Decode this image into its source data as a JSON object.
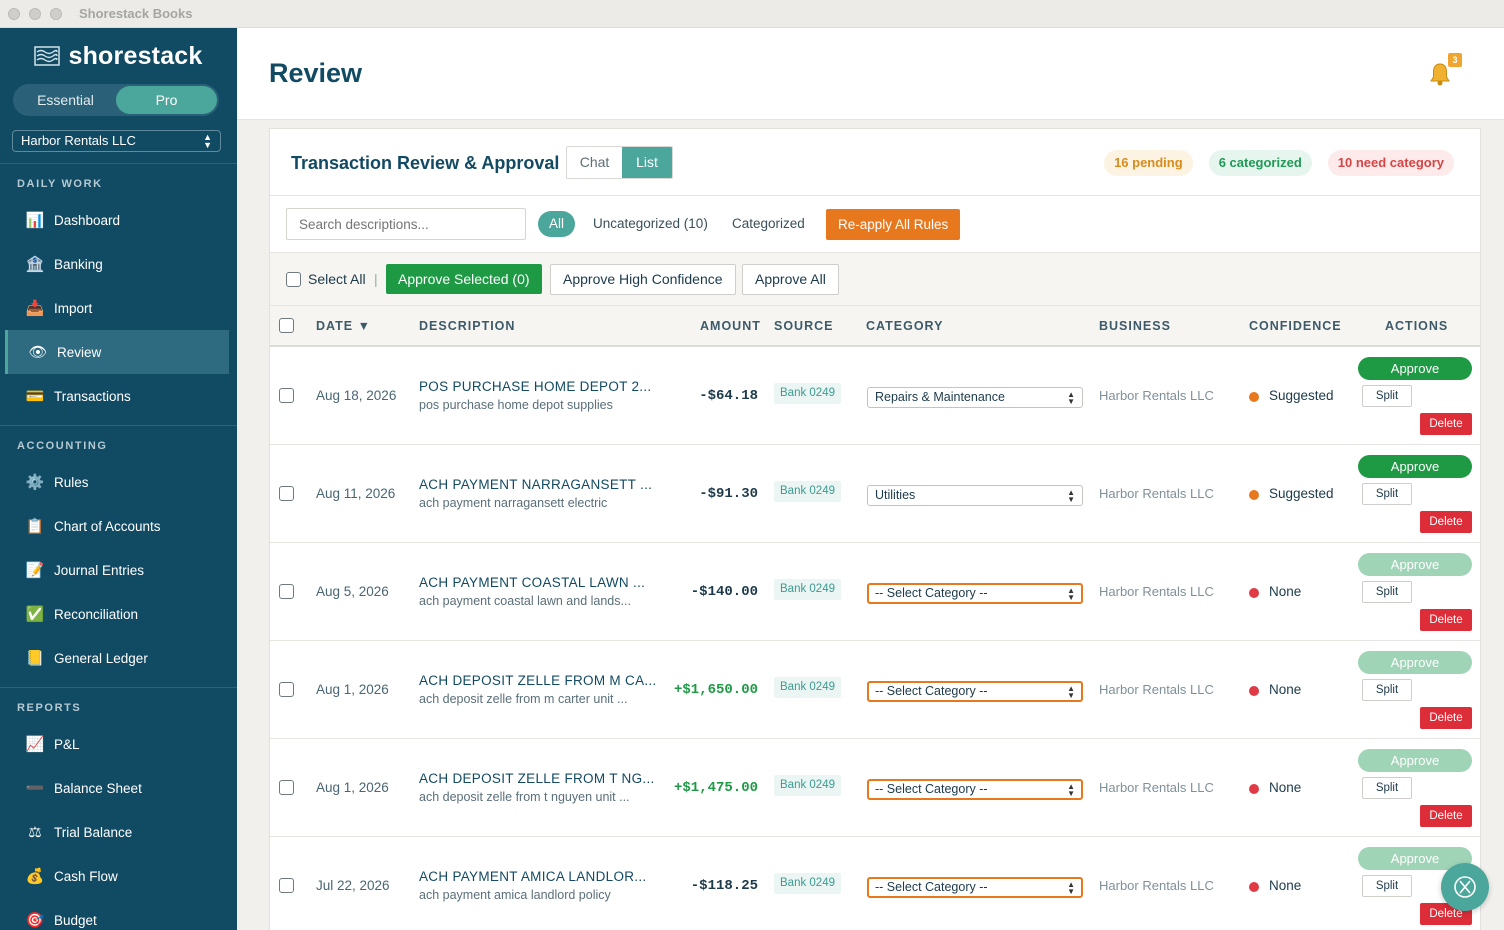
{
  "window": {
    "title": "Shorestack Books"
  },
  "brand": {
    "name": "shorestack"
  },
  "plans": {
    "essential": "Essential",
    "pro": "Pro"
  },
  "company": {
    "selected": "Harbor Rentals LLC"
  },
  "sidebar": {
    "sections": [
      {
        "label": "DAILY WORK"
      },
      {
        "label": "ACCOUNTING"
      },
      {
        "label": "REPORTS"
      }
    ],
    "items": [
      {
        "label": "Dashboard",
        "icon": "📊"
      },
      {
        "label": "Banking",
        "icon": "🏦"
      },
      {
        "label": "Import",
        "icon": "📥"
      },
      {
        "label": "Review",
        "icon": "👁"
      },
      {
        "label": "Transactions",
        "icon": "💳"
      },
      {
        "label": "Rules",
        "icon": "⚙️"
      },
      {
        "label": "Chart of Accounts",
        "icon": "📋"
      },
      {
        "label": "Journal Entries",
        "icon": "📝"
      },
      {
        "label": "Reconciliation",
        "icon": "✅"
      },
      {
        "label": "General Ledger",
        "icon": "📒"
      },
      {
        "label": "P&L",
        "icon": "📈"
      },
      {
        "label": "Balance Sheet",
        "icon": "➖"
      },
      {
        "label": "Trial Balance",
        "icon": "⚖"
      },
      {
        "label": "Cash Flow",
        "icon": "💰"
      },
      {
        "label": "Budget",
        "icon": "🎯"
      }
    ]
  },
  "header": {
    "title": "Review",
    "notifications": "3"
  },
  "panel": {
    "title": "Transaction Review & Approval",
    "views": {
      "chat": "Chat",
      "list": "List"
    },
    "badges": {
      "pending": "16 pending",
      "categorized": "6 categorized",
      "need": "10 need category"
    }
  },
  "filters": {
    "search_placeholder": "Search descriptions...",
    "all": "All",
    "uncategorized": "Uncategorized (10)",
    "categorized": "Categorized",
    "reapply": "Re-apply All Rules"
  },
  "bulk": {
    "select_all": "Select All",
    "separator": "|",
    "approve_selected": "Approve Selected (0)",
    "approve_high": "Approve High Confidence",
    "approve_all": "Approve All"
  },
  "columns": {
    "date": "DATE ▼",
    "description": "DESCRIPTION",
    "amount": "AMOUNT",
    "source": "SOURCE",
    "category": "CATEGORY",
    "business": "BUSINESS",
    "confidence": "CONFIDENCE",
    "actions": "ACTIONS"
  },
  "actions": {
    "approve": "Approve",
    "split": "Split",
    "delete": "Delete"
  },
  "rows": [
    {
      "date": "Aug 18, 2026",
      "title": "POS PURCHASE HOME DEPOT 2...",
      "sub": "pos purchase home depot supplies",
      "amount": "-$64.18",
      "source": "Bank 0249",
      "category": "Repairs & Maintenance",
      "business": "Harbor Rentals LLC",
      "confidence": "Suggested"
    },
    {
      "date": "Aug 11, 2026",
      "title": "ACH PAYMENT NARRAGANSETT ...",
      "sub": "ach payment narragansett electric",
      "amount": "-$91.30",
      "source": "Bank 0249",
      "category": "Utilities",
      "business": "Harbor Rentals LLC",
      "confidence": "Suggested"
    },
    {
      "date": "Aug 5, 2026",
      "title": "ACH PAYMENT COASTAL LAWN ...",
      "sub": "ach payment coastal lawn and lands...",
      "amount": "-$140.00",
      "source": "Bank 0249",
      "category": "-- Select Category --",
      "business": "Harbor Rentals LLC",
      "confidence": "None"
    },
    {
      "date": "Aug 1, 2026",
      "title": "ACH DEPOSIT ZELLE FROM M CA...",
      "sub": "ach deposit zelle from m carter unit ...",
      "amount": "+$1,650.00",
      "source": "Bank 0249",
      "category": "-- Select Category --",
      "business": "Harbor Rentals LLC",
      "confidence": "None"
    },
    {
      "date": "Aug 1, 2026",
      "title": "ACH DEPOSIT ZELLE FROM T NG...",
      "sub": "ach deposit zelle from t nguyen unit ...",
      "amount": "+$1,475.00",
      "source": "Bank 0249",
      "category": "-- Select Category --",
      "business": "Harbor Rentals LLC",
      "confidence": "None"
    },
    {
      "date": "Jul 22, 2026",
      "title": "ACH PAYMENT AMICA LANDLOR...",
      "sub": "ach payment amica landlord policy",
      "amount": "-$118.25",
      "source": "Bank 0249",
      "category": "-- Select Category --",
      "business": "Harbor Rentals LLC",
      "confidence": "None"
    }
  ],
  "colors": {
    "sidebar": "#114a63",
    "accent": "#4ba69c",
    "approve": "#1e9a45",
    "delete": "#dc2d39",
    "orange": "#e8781e",
    "suggested_dot": "#e8781e",
    "none_dot": "#e03a45"
  }
}
